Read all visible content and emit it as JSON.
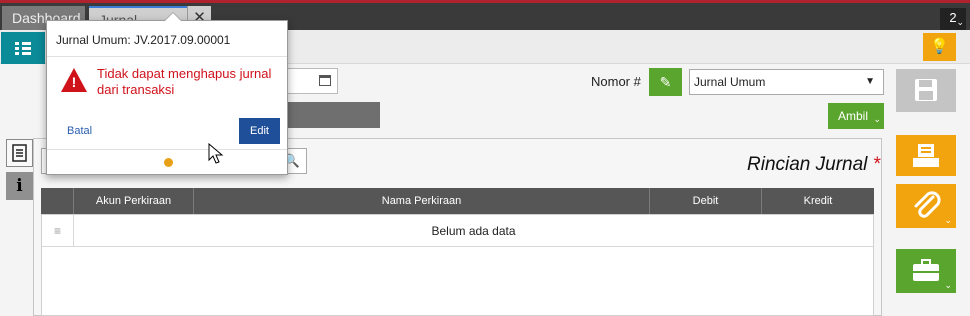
{
  "tabs": {
    "dashboard": "Dashboard",
    "jurnal": "Jurnal Umum",
    "close": "✕",
    "count": "2"
  },
  "form": {
    "nomor_label": "Nomor #",
    "jenis_value": "Jurnal Umum",
    "ambil_label": "Ambil"
  },
  "panel": {
    "title": "Rincian Jurnal",
    "required_mark": "*",
    "columns": [
      "Akun Perkiraan",
      "Nama Perkiraan",
      "Debit",
      "Kredit"
    ],
    "empty_text": "Belum ada data"
  },
  "popover": {
    "title": "Jurnal Umum: JV.2017.09.00001",
    "message": "Tidak dapat menghapus jurnal dari transaksi",
    "cancel_label": "Batal",
    "edit_label": "Edit"
  },
  "colors": {
    "accent_green": "#5aa52d",
    "accent_orange": "#f2a40f",
    "accent_teal": "#0b8a97",
    "error_red": "#d0121b",
    "primary_blue": "#1f4f99"
  }
}
